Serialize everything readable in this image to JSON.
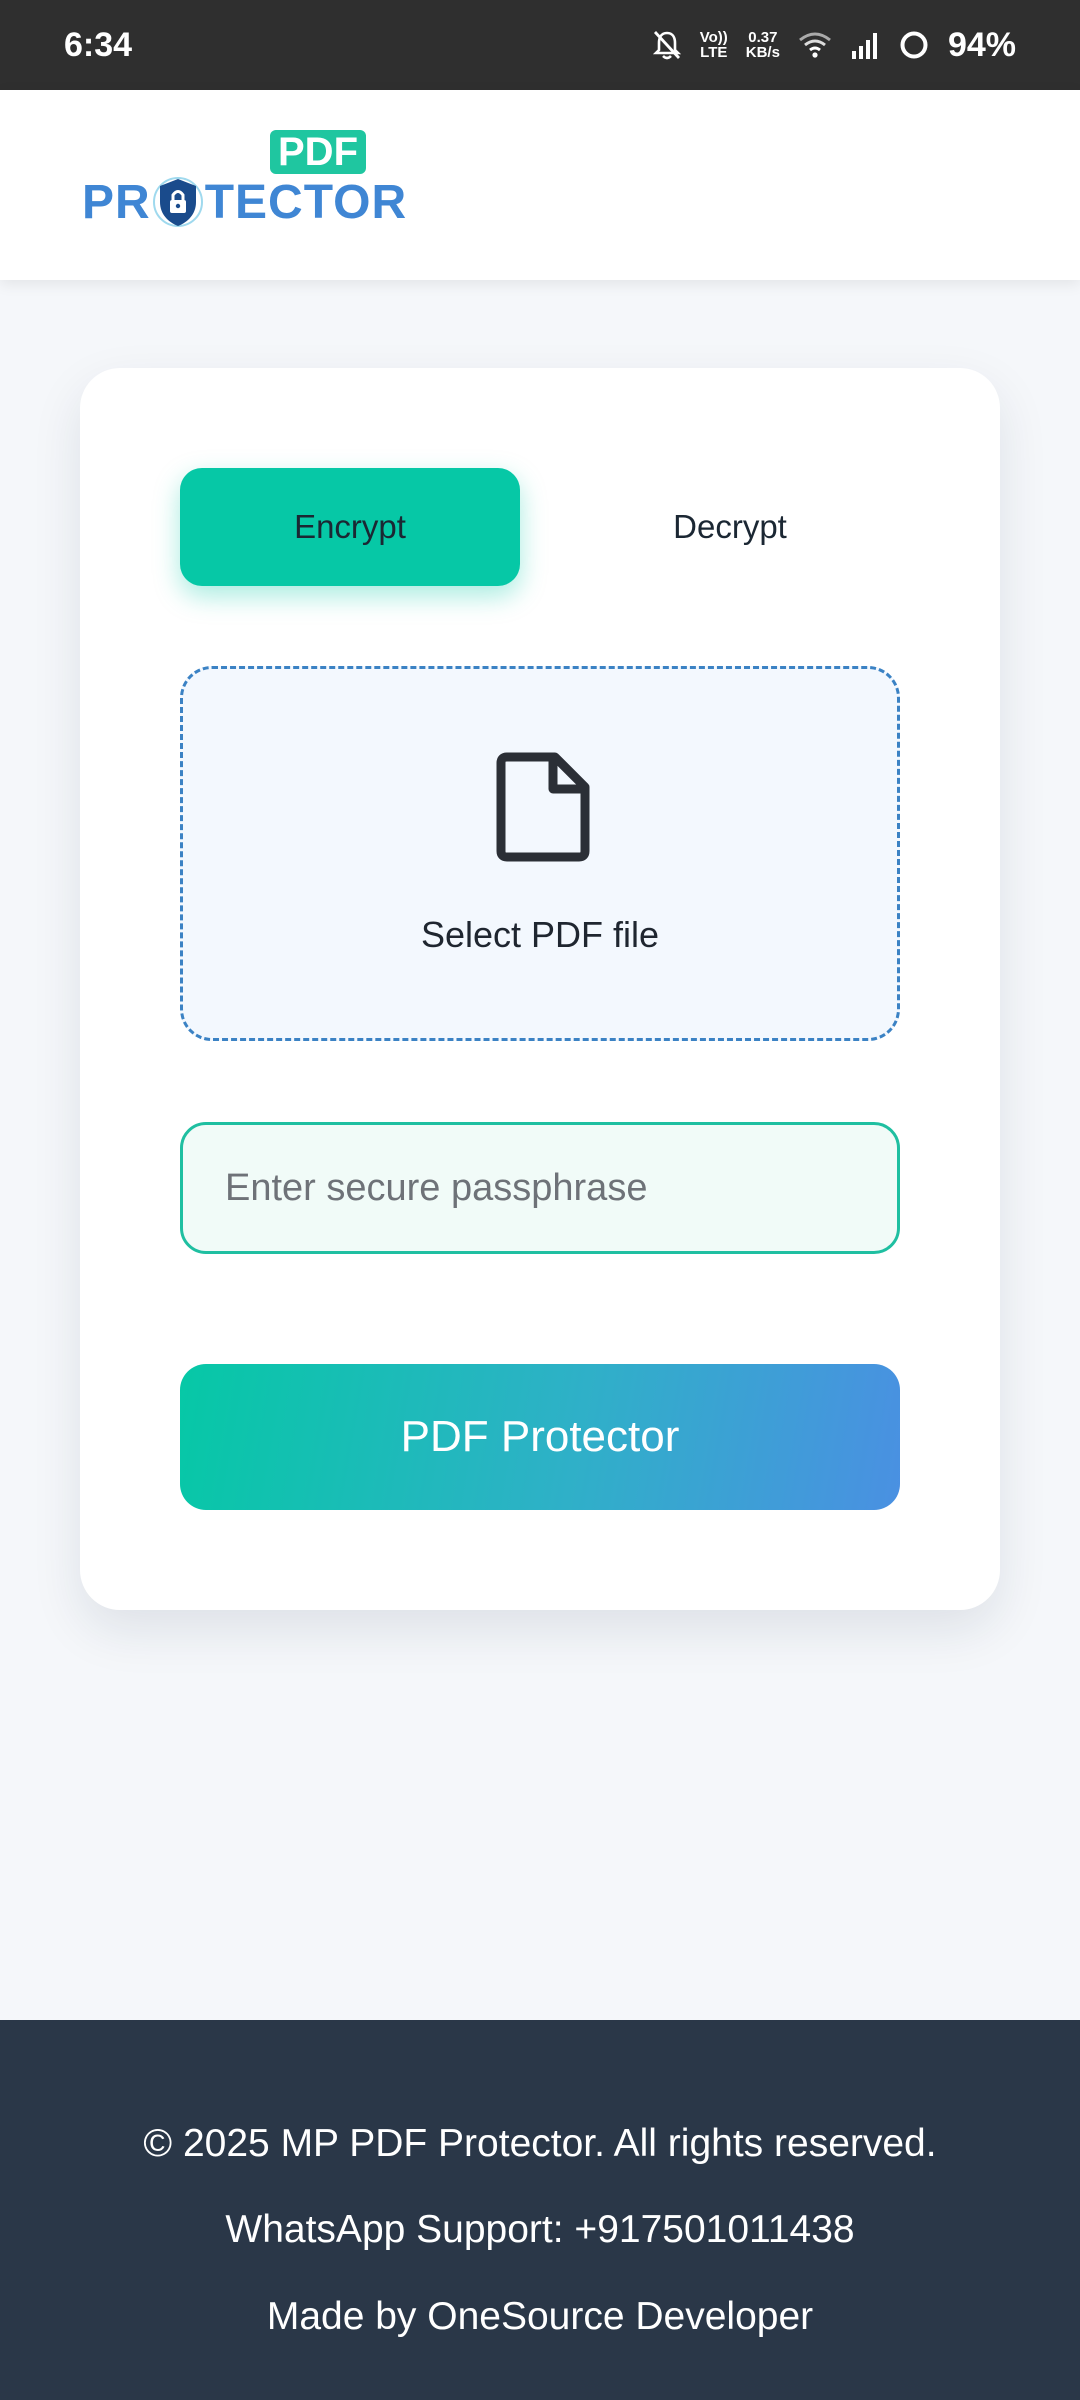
{
  "status_bar": {
    "time": "6:34",
    "volte_label": "Vo)) LTE",
    "speed_value": "0.37",
    "speed_unit": "KB/s",
    "battery": "94%",
    "icons": [
      "bell-muted-icon",
      "volte-icon",
      "wifi-icon",
      "signal-icon",
      "battery-ring-icon"
    ]
  },
  "header": {
    "logo_badge": "PDF",
    "logo_word_left": "PR",
    "logo_word_right": "TECTOR"
  },
  "tabs": {
    "encrypt": "Encrypt",
    "decrypt": "Decrypt",
    "active": "encrypt"
  },
  "dropzone": {
    "icon": "file-icon",
    "label": "Select PDF file"
  },
  "passphrase": {
    "value": "",
    "placeholder": "Enter secure passphrase"
  },
  "submit": {
    "label": "PDF Protector"
  },
  "footer": {
    "copyright": "© 2025 MP PDF Protector. All rights reserved.",
    "support": "WhatsApp Support: +917501011438",
    "credit": "Made by OneSource Developer"
  },
  "colors": {
    "accent": "#06c8a6",
    "accent_blue": "#4a90e2",
    "footer_bg": "#2a3748",
    "status_bg": "#2f2f2f"
  }
}
